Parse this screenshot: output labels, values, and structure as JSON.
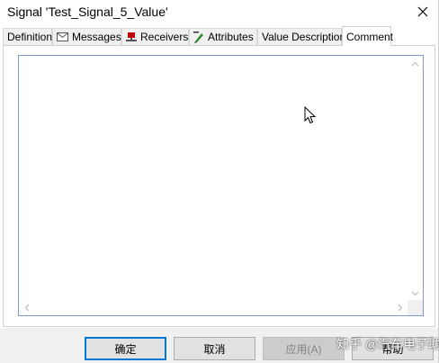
{
  "window": {
    "title": "Signal 'Test_Signal_5_Value'"
  },
  "tabs": [
    {
      "label": "Definition",
      "icon": ""
    },
    {
      "label": "Messages",
      "icon": "envelope-icon"
    },
    {
      "label": "Receivers",
      "icon": "receiver-node-icon"
    },
    {
      "label": "Attributes",
      "icon": "attribute-pen-icon"
    },
    {
      "label": "Value Descriptions",
      "icon": ""
    },
    {
      "label": "Comment",
      "icon": "",
      "active": true
    }
  ],
  "comment": {
    "value": ""
  },
  "buttons": {
    "ok": "确定",
    "cancel": "取消",
    "apply": "应用(A)",
    "help": "帮助"
  },
  "watermark": "知乎 @汽车电子助手",
  "colors": {
    "accent": "#0078d7",
    "text_box_border": "#7a9cc4",
    "receiver_icon_red": "#c00000",
    "attribute_icon_green": "#2e8b2e"
  }
}
